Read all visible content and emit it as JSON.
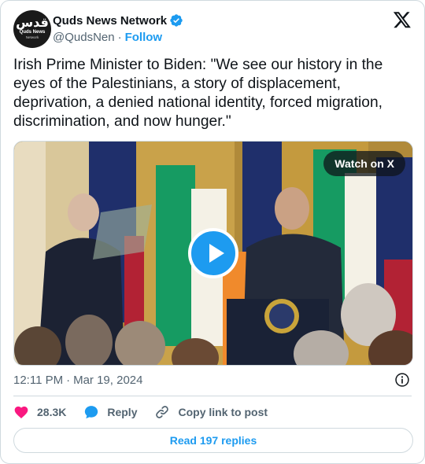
{
  "account": {
    "display_name": "Quds News Network",
    "handle": "@QudsNen",
    "follow_label": "Follow",
    "avatar_text_main": "قدس",
    "avatar_text_sub": "Quds News",
    "avatar_text_sub2": "Network"
  },
  "tweet": {
    "text": "Irish Prime Minister to Biden: \"We see our history in the eyes of the Palestinians, a story of displacement, deprivation, a denied national identity, forced migration, discrimination, and now hunger.\"",
    "time": "12:11 PM",
    "date": "Mar 19, 2024"
  },
  "media": {
    "watch_label": "Watch on X"
  },
  "actions": {
    "likes": "28.3K",
    "reply_label": "Reply",
    "copy_label": "Copy link to post"
  },
  "footer": {
    "read_replies_label": "Read 197 replies"
  },
  "colors": {
    "accent": "#1d9bf0",
    "like": "#f91880",
    "text_secondary": "#536471",
    "border": "#cfd9de"
  },
  "icons": [
    "verified-badge-icon",
    "x-logo-icon",
    "play-icon",
    "info-icon",
    "heart-icon",
    "reply-bubble-icon",
    "link-icon"
  ]
}
